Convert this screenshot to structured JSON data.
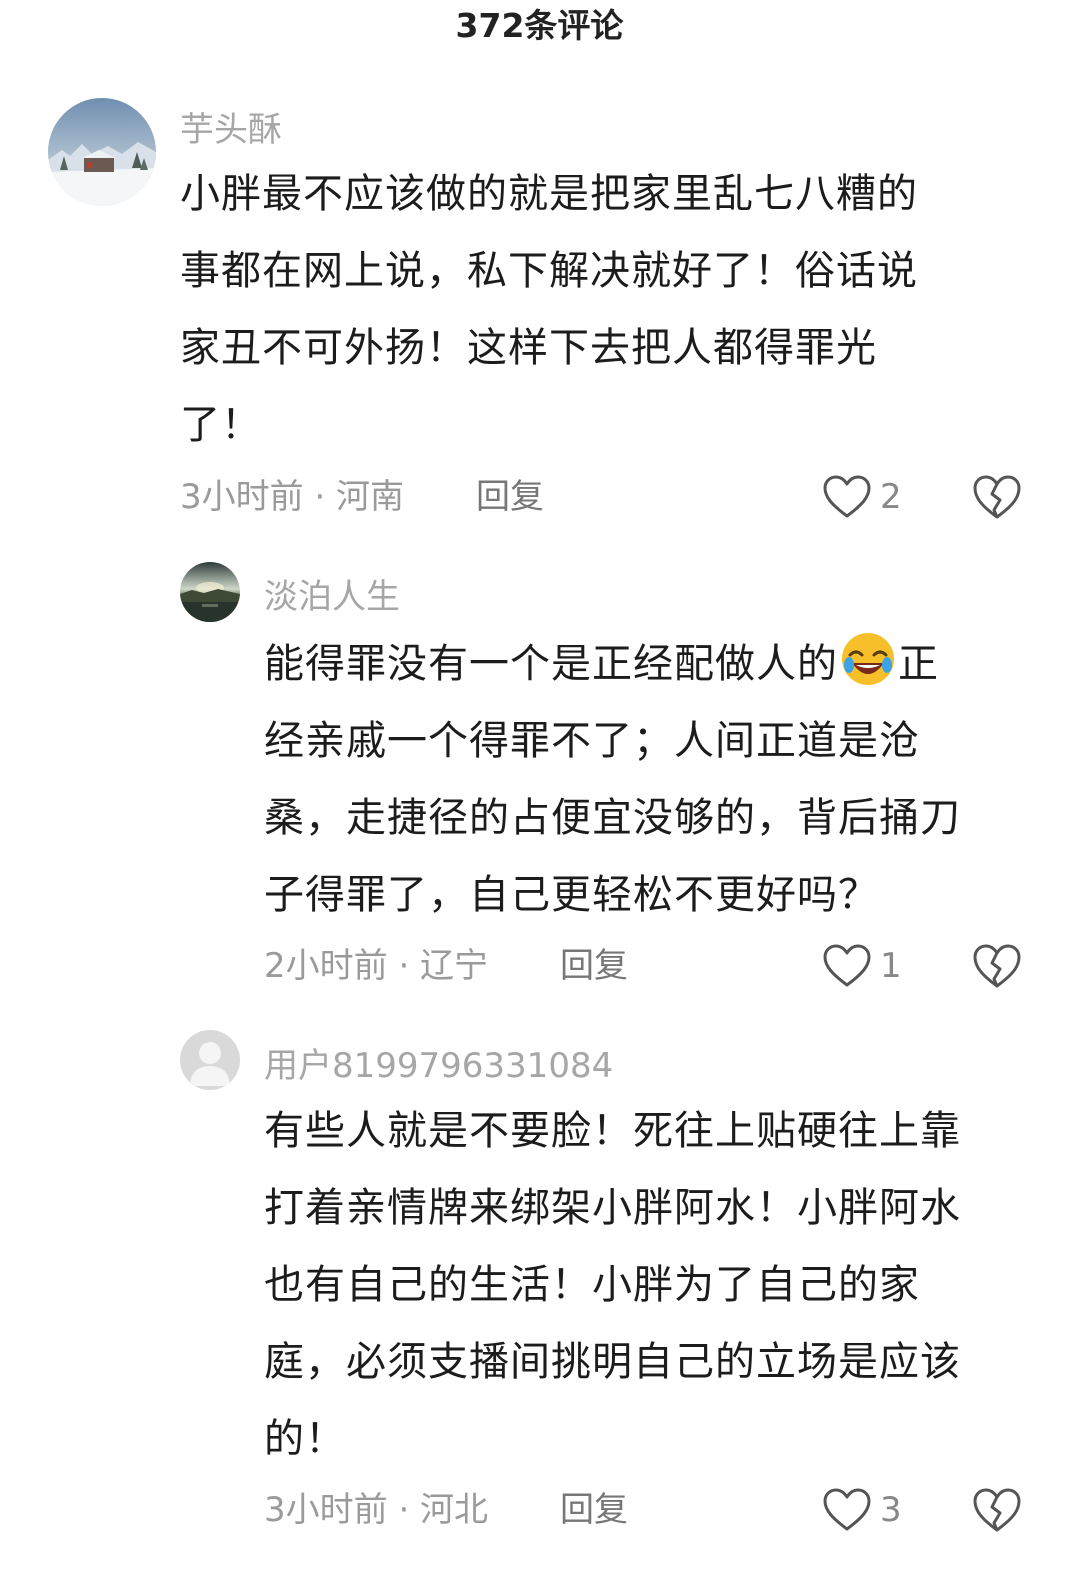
{
  "header": {
    "title": "372条评论"
  },
  "comments": [
    {
      "username": "芋头酥",
      "avatar_icon": "snow-landscape-avatar",
      "lines": [
        "小胖最不应该做的就是把家里乱七八糟的",
        "事都在网上说，私下解决就好了！俗话说",
        "家丑不可外扬！这样下去把人都得罪光",
        "了！"
      ],
      "meta": "3小时前 · 河南",
      "reply_label": "回复",
      "likes": "2"
    },
    {
      "username": "淡泊人生",
      "avatar_icon": "lake-sunset-avatar",
      "line1_before": "能得罪没有一个是正经配做人的",
      "emoji_icon": "rofl-emoji",
      "line1_after": "正",
      "lines": [
        "经亲戚一个得罪不了；人间正道是沧",
        "桑，走捷径的占便宜没够的，背后捅刀",
        "子得罪了，自己更轻松不更好吗？"
      ],
      "meta": "2小时前 · 辽宁",
      "reply_label": "回复",
      "likes": "1"
    },
    {
      "username": "用户8199796331084",
      "avatar_icon": "default-user-avatar",
      "lines": [
        "有些人就是不要脸！死往上贴硬往上靠",
        "打着亲情牌来绑架小胖阿水！小胖阿水",
        "也有自己的生活！小胖为了自己的家",
        "庭，必须支播间挑明自己的立场是应该",
        "的！"
      ],
      "meta": "3小时前 · 河北",
      "reply_label": "回复",
      "likes": "3"
    }
  ],
  "icons": {
    "like": "heart-outline-icon",
    "dislike": "broken-heart-icon"
  }
}
